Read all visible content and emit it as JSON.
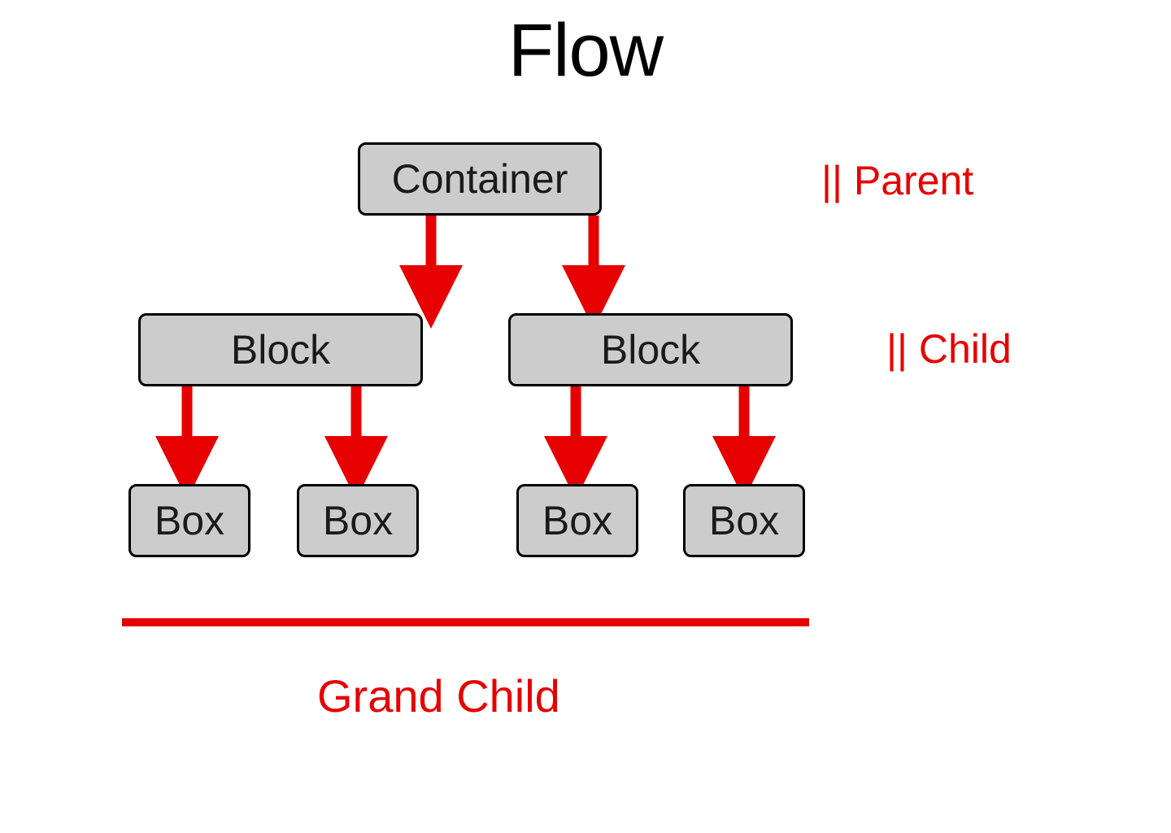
{
  "title": "Flow",
  "nodes": {
    "container": "Container",
    "block_left": "Block",
    "block_right": "Block",
    "box_1": "Box",
    "box_2": "Box",
    "box_3": "Box",
    "box_4": "Box"
  },
  "annotations": {
    "parent": "|| Parent",
    "child": "|| Child",
    "grandchild": "Grand Child"
  },
  "colors": {
    "node_bg": "#cccccc",
    "node_border": "#000000",
    "accent": "#e60000",
    "text": "#1a1a1a"
  }
}
